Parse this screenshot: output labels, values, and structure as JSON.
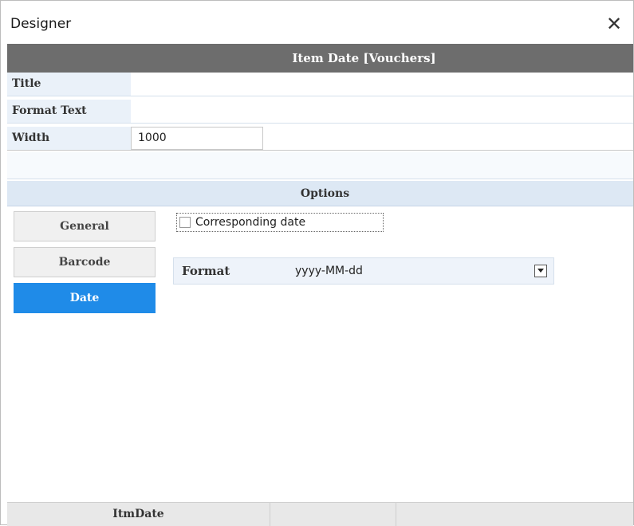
{
  "window": {
    "title": "Designer",
    "close_icon": "close-icon",
    "close_glyph": "✕"
  },
  "header": {
    "title": "Item Date [Vouchers]"
  },
  "properties": {
    "title_label": "Title",
    "title_value": "",
    "format_text_label": "Format Text",
    "format_text_value": "",
    "width_label": "Width",
    "width_value": "1000"
  },
  "options": {
    "title": "Options"
  },
  "tabs": [
    {
      "label": "General",
      "active": false
    },
    {
      "label": "Barcode",
      "active": false
    },
    {
      "label": "Date",
      "active": true
    }
  ],
  "date_options": {
    "corresponding_date_label": "Corresponding date",
    "corresponding_date_checked": false,
    "format_label": "Format",
    "format_value": "yyyy-MM-dd",
    "dropdown_icon": "chevron-down-icon"
  },
  "statusbar": {
    "field_name": "ItmDate"
  },
  "colors": {
    "header_bg": "#6d6d6d",
    "active_tab": "#1f8be8",
    "label_bg": "#eaf1f9"
  }
}
